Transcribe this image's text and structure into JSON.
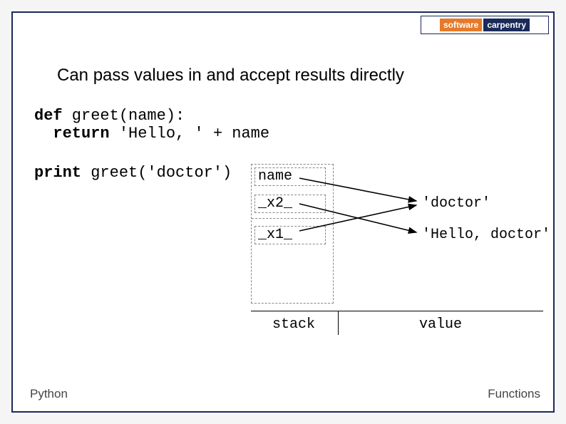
{
  "logo": {
    "left": "software",
    "right": "carpentry"
  },
  "title": "Can pass values in and accept results directly",
  "code": {
    "def": "def",
    "line1_rest": " greet(name):",
    "return": "return",
    "line2_rest": " 'Hello, ' + name",
    "print": "print",
    "line3_rest": " greet('doctor')"
  },
  "diagram": {
    "cells": {
      "name": "name",
      "x2": "_x2_",
      "x1": "_x1_"
    },
    "values": {
      "v1": "'doctor'",
      "v2": "'Hello, doctor'"
    },
    "labels": {
      "stack": "stack",
      "value": "value"
    }
  },
  "footer": {
    "left": "Python",
    "right": "Functions"
  }
}
